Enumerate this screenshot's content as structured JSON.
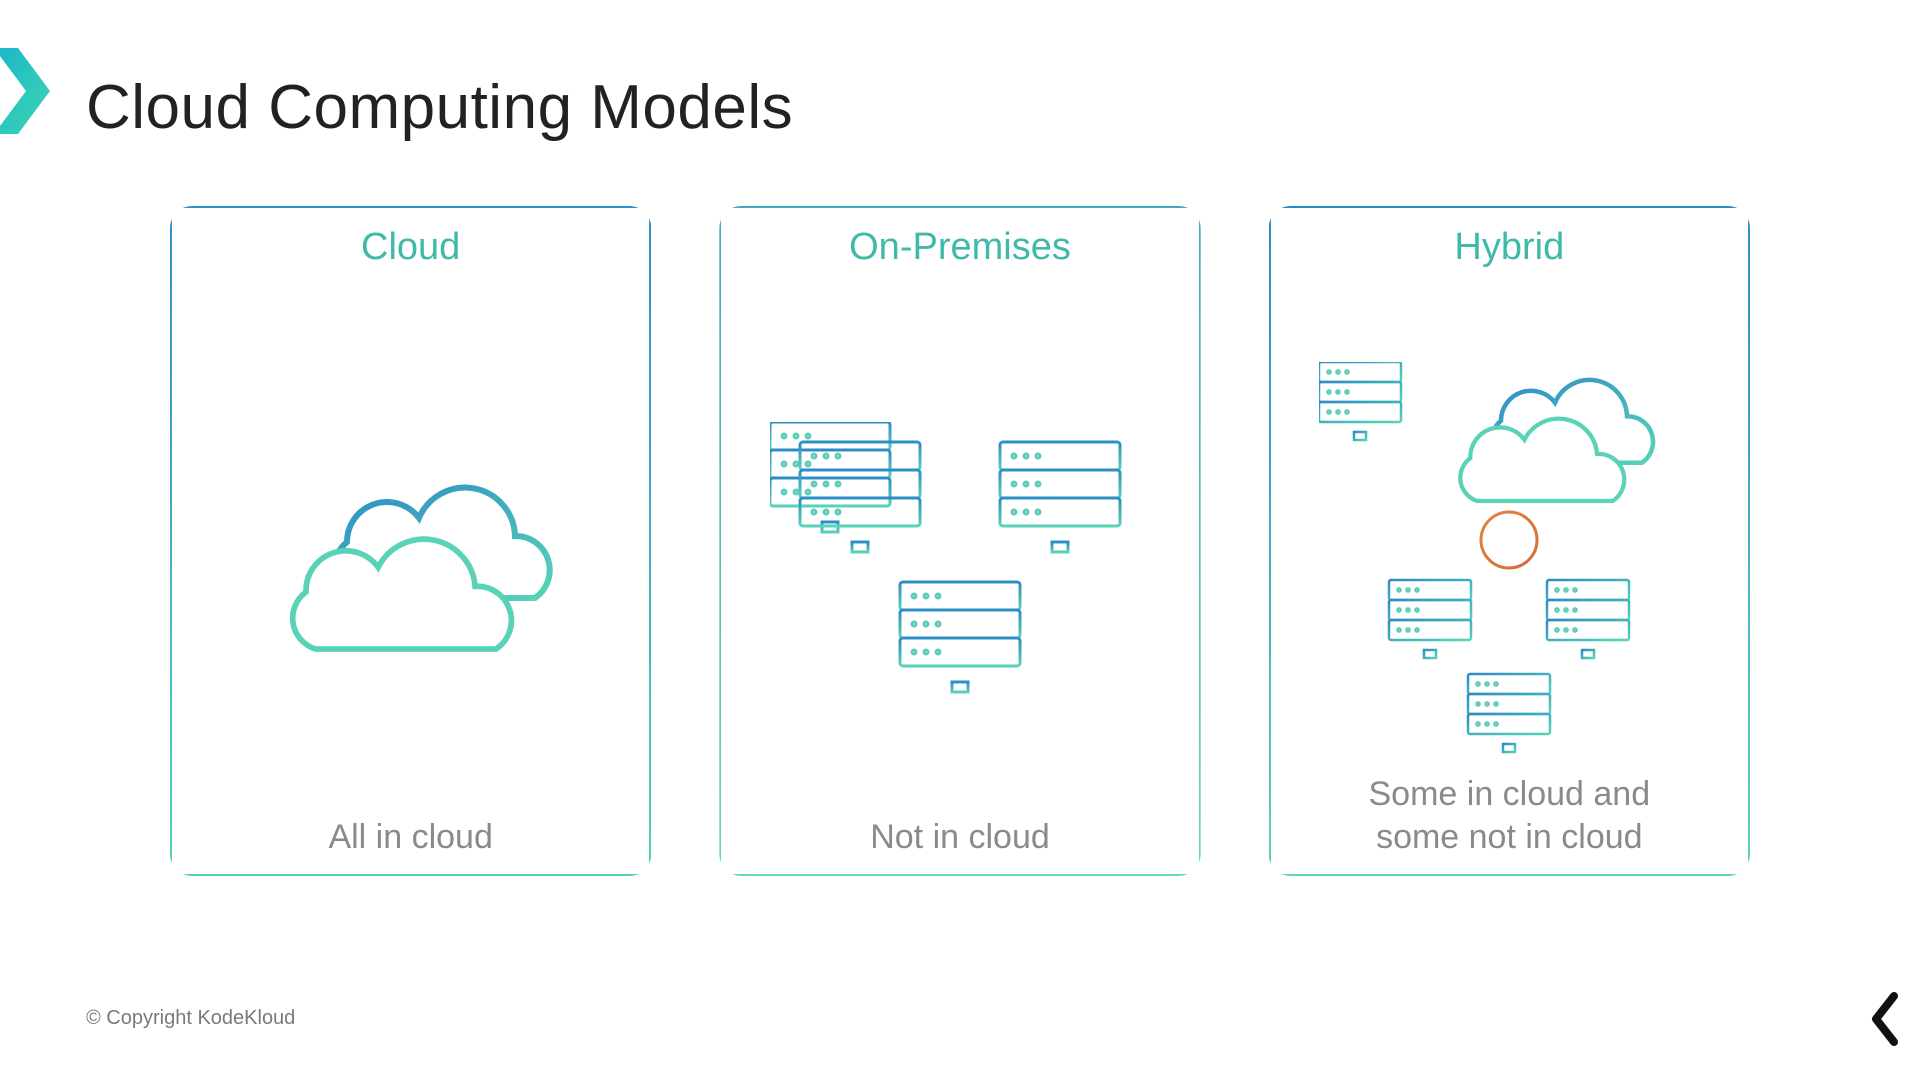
{
  "title": "Cloud Computing Models",
  "cards": [
    {
      "title": "Cloud",
      "desc": "All in cloud"
    },
    {
      "title": "On-Premises",
      "desc": "Not in cloud"
    },
    {
      "title": "Hybrid",
      "desc": "Some in cloud and\nsome not in cloud"
    }
  ],
  "copyright": "© Copyright KodeKloud"
}
